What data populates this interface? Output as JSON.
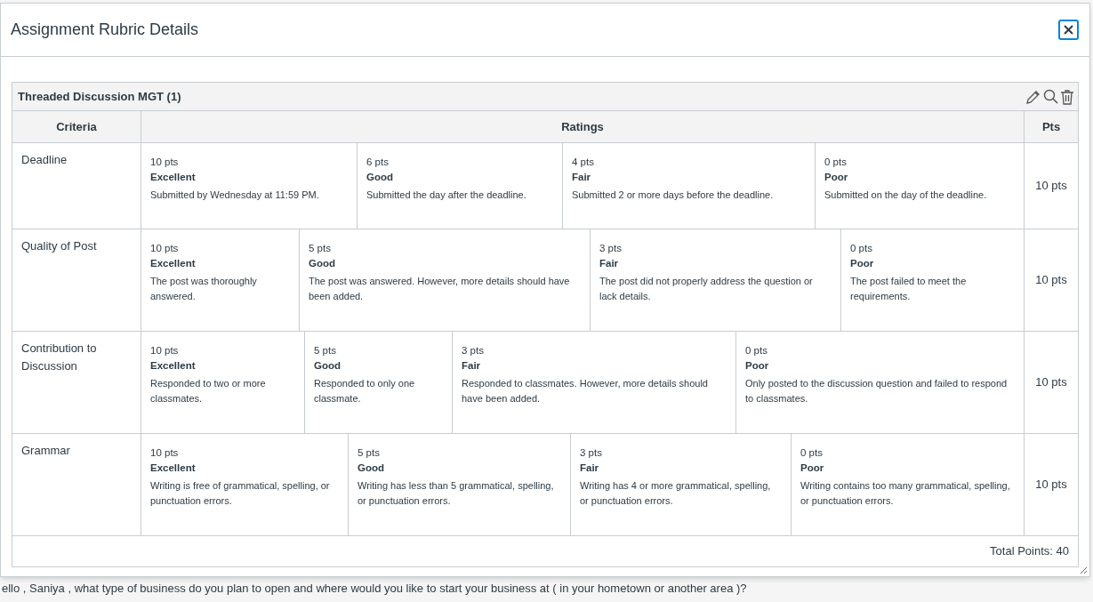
{
  "dialog": {
    "title": "Assignment Rubric Details"
  },
  "rubric": {
    "title": "Threaded Discussion MGT (1)",
    "columns": [
      "Criteria",
      "Ratings",
      "Pts"
    ],
    "rows": [
      {
        "criterion": "Deadline",
        "points": "10 pts",
        "ratings": [
          {
            "points": "10 pts",
            "label": "Excellent",
            "description": "Submitted by Wednesday at 11:59 PM."
          },
          {
            "points": "6 pts",
            "label": "Good",
            "description": "Submitted the day after the deadline."
          },
          {
            "points": "4 pts",
            "label": "Fair",
            "description": "Submitted 2 or more days before the deadline."
          },
          {
            "points": "0 pts",
            "label": "Poor",
            "description": "Submitted on the day of the deadline."
          }
        ]
      },
      {
        "criterion": "Quality of Post",
        "points": "10 pts",
        "ratings": [
          {
            "points": "10 pts",
            "label": "Excellent",
            "description": "The post was thoroughly answered."
          },
          {
            "points": "5 pts",
            "label": "Good",
            "description": "The post was answered. However, more details should have been added."
          },
          {
            "points": "3 pts",
            "label": "Fair",
            "description": "The post did not properly address the question or lack details."
          },
          {
            "points": "0 pts",
            "label": "Poor",
            "description": "The post failed to meet the requirements."
          }
        ]
      },
      {
        "criterion": "Contribution to Discussion",
        "points": "10 pts",
        "ratings": [
          {
            "points": "10 pts",
            "label": "Excellent",
            "description": "Responded to two or more classmates."
          },
          {
            "points": "5 pts",
            "label": "Good",
            "description": "Responded to only one classmate."
          },
          {
            "points": "3 pts",
            "label": "Fair",
            "description": "Responded to classmates. However, more details should have been added."
          },
          {
            "points": "0 pts",
            "label": "Poor",
            "description": "Only posted to the discussion question and failed to respond to classmates."
          }
        ]
      },
      {
        "criterion": "Grammar",
        "points": "10 pts",
        "ratings": [
          {
            "points": "10 pts",
            "label": "Excellent",
            "description": "Writing is free of grammatical, spelling, or punctuation errors."
          },
          {
            "points": "5 pts",
            "label": "Good",
            "description": "Writing has less than 5 grammatical, spelling, or punctuation errors."
          },
          {
            "points": "3 pts",
            "label": "Fair",
            "description": "Writing has 4 or more grammatical, spelling, or punctuation errors."
          },
          {
            "points": "0 pts",
            "label": "Poor",
            "description": "Writing contains too many grammatical, spelling, or punctuation errors."
          }
        ]
      }
    ],
    "total": "Total Points: 40"
  },
  "background_text": "ello , Saniya , what type of business do you plan to open and where would you like to start your business at ( in your hometown or another area )?"
}
